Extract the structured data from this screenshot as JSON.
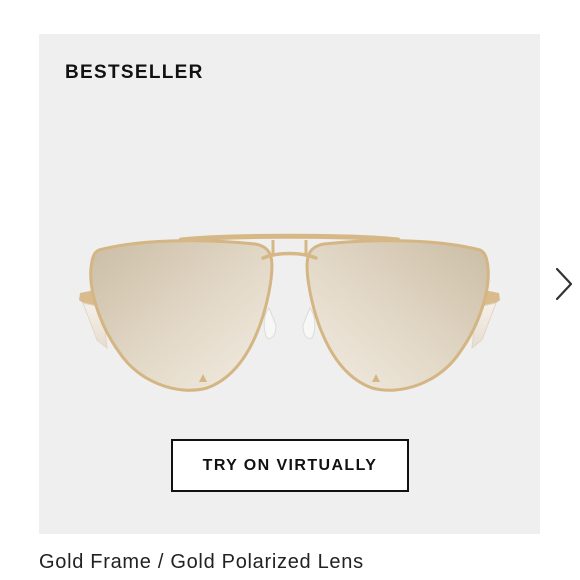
{
  "product": {
    "badge": "BESTSELLER",
    "image_alt": "gold aviator sunglasses",
    "cta_label": "TRY ON VIRTUALLY",
    "caption": "Gold Frame / Gold Polarized Lens"
  },
  "carousel": {
    "next_icon": "chevron-right-icon"
  },
  "colors": {
    "card_background": "#efefef",
    "frame_gold": "#d8b98c",
    "lens_gold": "#d9cbb4",
    "text": "#111111"
  }
}
